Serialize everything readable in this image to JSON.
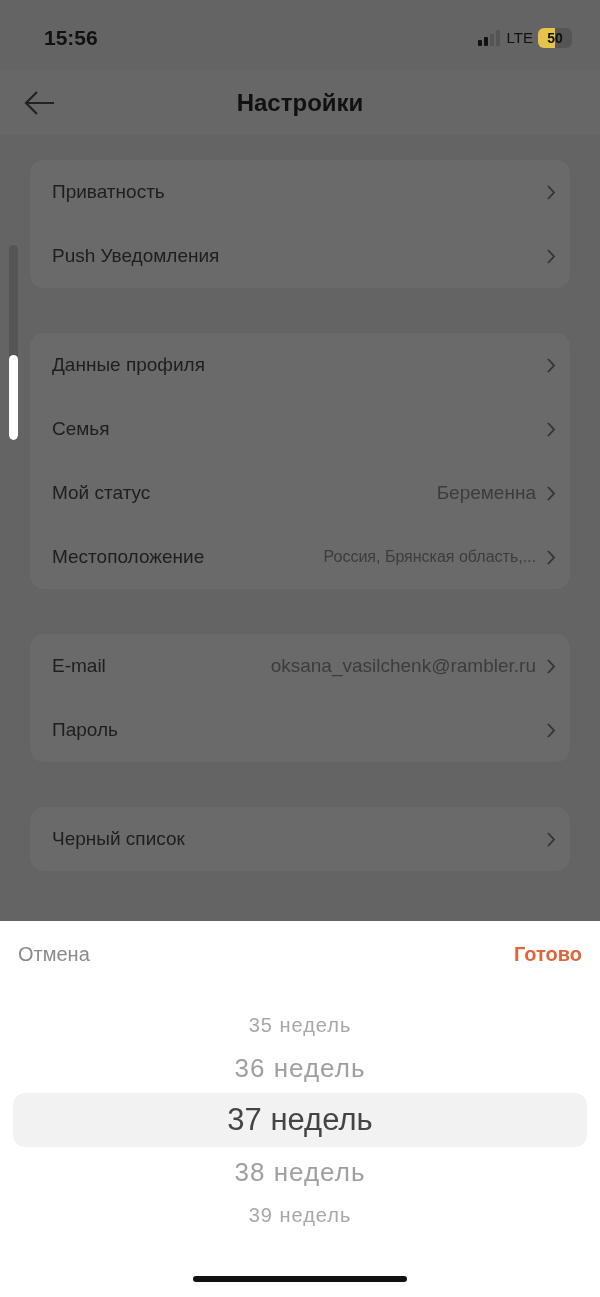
{
  "status_bar": {
    "time": "15:56",
    "network": "LTE",
    "battery": "50"
  },
  "header": {
    "title": "Настройки"
  },
  "groups": [
    {
      "rows": [
        {
          "label": "Приватность"
        },
        {
          "label": "Push Уведомления"
        }
      ]
    },
    {
      "rows": [
        {
          "label": "Данные профиля"
        },
        {
          "label": "Семья"
        },
        {
          "label": "Мой статус",
          "value": "Беременна"
        },
        {
          "label": "Местоположение",
          "value": "Россия, Брянская область,...",
          "small": true
        }
      ]
    },
    {
      "rows": [
        {
          "label": "E-mail",
          "value": "oksana_vasilchenk@rambler.ru"
        },
        {
          "label": "Пароль"
        }
      ]
    },
    {
      "rows": [
        {
          "label": "Черный список"
        }
      ]
    }
  ],
  "picker": {
    "cancel": "Отмена",
    "done": "Готово",
    "options": [
      {
        "label": "35 недель",
        "selected": false
      },
      {
        "label": "36 недель",
        "selected": false
      },
      {
        "label": "37 недель",
        "selected": true
      },
      {
        "label": "38 недель",
        "selected": false
      },
      {
        "label": "39 недель",
        "selected": false
      }
    ]
  }
}
